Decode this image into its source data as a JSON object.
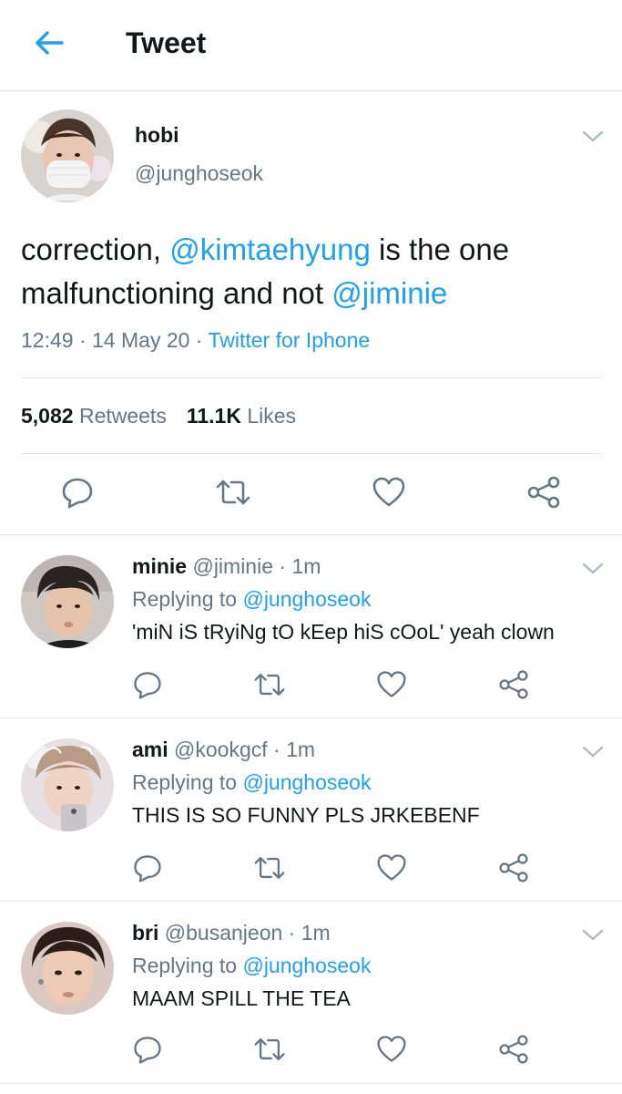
{
  "header": {
    "title": "Tweet",
    "back_icon": "arrow-left-icon"
  },
  "colors": {
    "accent": "#1da1f2",
    "secondary_text": "#657786",
    "divider": "#e1e8ed"
  },
  "main_tweet": {
    "name": "hobi",
    "handle": "@junghoseok",
    "text_1": "correction, ",
    "mention_1": "@kimtaehyung",
    "text_2": " is the one malfunctioning and not ",
    "mention_2": "@jiminie",
    "time": "12:49",
    "sep_1": " · ",
    "date": "14 May 20",
    "sep_2": " · ",
    "source": "Twitter for Iphone",
    "retweets_count": "5,082",
    "retweets_label": " Retweets",
    "likes_count": "11.1K",
    "likes_label": " Likes"
  },
  "replies": [
    {
      "name": "minie",
      "handle": "@jiminie",
      "time": "· 1m",
      "replying_label": "Replying to ",
      "replying_to": "@junghoseok",
      "text": "'miN iS tRyiNg tO kEep hiS cOoL' yeah clown"
    },
    {
      "name": "ami",
      "handle": "@kookgcf",
      "time": "· 1m",
      "replying_label": "Replying to ",
      "replying_to": "@junghoseok",
      "text": "THIS IS SO FUNNY PLS JRKEBENF"
    },
    {
      "name": "bri",
      "handle": "@busanjeon",
      "time": "· 1m",
      "replying_label": "Replying to ",
      "replying_to": "@junghoseok",
      "text": "MAAM SPILL THE TEA"
    }
  ]
}
